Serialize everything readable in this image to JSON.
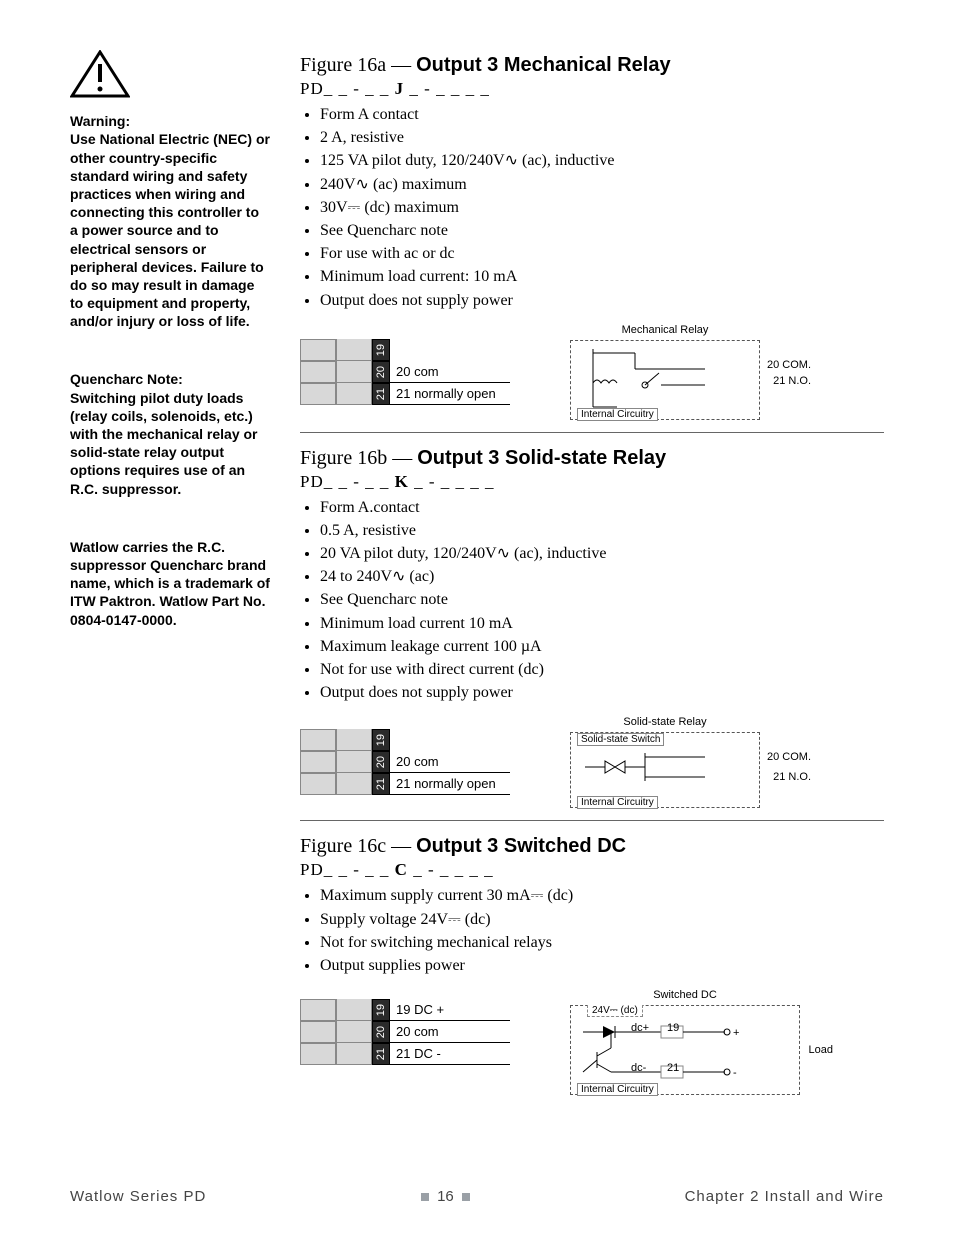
{
  "sidebar": {
    "warning_head": "Warning:",
    "warning_body": "Use National Electric (NEC) or other country-specific standard wiring and safety practices when wiring and connecting this controller to a power source and to electrical sensors or peripheral devices. Failure to do so may result in damage to equipment and property, and/or injury or loss of life.",
    "quench_head": "Quencharc Note:",
    "quench_body": "Switching pilot duty loads (relay coils, solenoids, etc.) with the mechanical relay or solid-state relay output options requires use of an R.C. suppressor.",
    "quench_extra": "Watlow carries the R.C. suppressor Quencharc brand name, which is a trademark of ITW Paktron. Watlow Part No. 0804-0147-0000."
  },
  "fig16a": {
    "ref": "Figure 16a —",
    "title": "Output 3 Mechanical Relay",
    "pd_pre": "PD_ _ - _ _ ",
    "pd_key": "J",
    "pd_post": " _ - _ _ _ _",
    "specs": [
      "Form A contact",
      "2 A, resistive",
      "125 VA pilot duty, 120/240V∿ (ac), inductive",
      "240V∿ (ac) maximum",
      "30V⎓ (dc) maximum",
      "See Quencharc note",
      "For use with ac or dc",
      "Minimum load current: 10 mA",
      "Output does not supply power"
    ],
    "term": {
      "r19": "19",
      "r20": "20",
      "r21": "21",
      "t20": "20  com",
      "t21": "21  normally open"
    },
    "schem": {
      "title": "Mechanical Relay",
      "sub": "Internal Circuitry",
      "l1": "20  COM.",
      "l2": "21  N.O."
    }
  },
  "fig16b": {
    "ref": "Figure 16b —",
    "title": "Output 3 Solid-state Relay",
    "pd_pre": "PD_ _ - _ _ ",
    "pd_key": "K",
    "pd_post": " _ - _ _ _ _",
    "specs": [
      "Form A.contact",
      "0.5 A, resistive",
      "20 VA pilot duty, 120/240V∿ (ac), inductive",
      "24 to 240V∿ (ac)",
      "See Quencharc note",
      "Minimum load current 10 mA",
      "Maximum leakage current 100 µA",
      "Not for use with direct current (dc)",
      "Output does not supply power"
    ],
    "term": {
      "r19": "19",
      "r20": "20",
      "r21": "21",
      "t20": "20  com",
      "t21": "21  normally open"
    },
    "schem": {
      "title1": "Solid-state Relay",
      "title2": "Solid-state Switch",
      "sub": "Internal Circuitry",
      "l1": "20  COM.",
      "l2": "21  N.O."
    }
  },
  "fig16c": {
    "ref": "Figure 16c —",
    "title": "Output 3 Switched DC",
    "pd_pre": "PD_ _ - _ _ ",
    "pd_key": "C",
    "pd_post": " _ - _ _ _ _",
    "specs": [
      "Maximum supply current 30 mA⎓ (dc)",
      "Supply voltage 24V⎓ (dc)",
      "Not for switching mechanical relays",
      "Output supplies power"
    ],
    "term": {
      "r19": "19",
      "r20": "20",
      "r21": "21",
      "t19": "19  DC +",
      "t20": "20  com",
      "t21": "21  DC -"
    },
    "schem": {
      "title1": "Switched DC",
      "title2": "24V⎓ (dc)",
      "sub": "Internal Circuitry",
      "l1": "dc+",
      "l2": "dc-",
      "p1": "19",
      "p2": "21",
      "load": "Load"
    }
  },
  "footer": {
    "left": "Watlow Series PD",
    "page": "16",
    "right": "Chapter 2 Install and Wire"
  }
}
